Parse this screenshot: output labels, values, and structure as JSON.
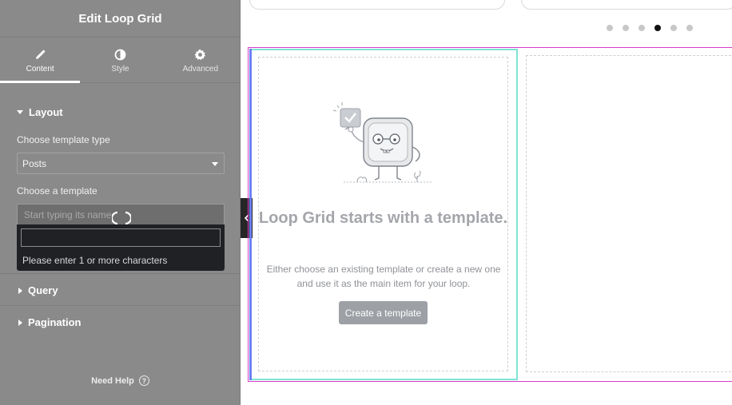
{
  "panel": {
    "title": "Edit Loop Grid",
    "tabs": [
      {
        "label": "Content",
        "icon": "pencil-icon",
        "active": true
      },
      {
        "label": "Style",
        "icon": "half-circle-icon",
        "active": false
      },
      {
        "label": "Advanced",
        "icon": "gear-icon",
        "active": false
      }
    ],
    "sections": {
      "layout": "Layout",
      "query": "Query",
      "pagination": "Pagination"
    },
    "template_type_label": "Choose template type",
    "template_type_value": "Posts",
    "template_label": "Choose a template",
    "template_placeholder": "Start typing its name",
    "dropdown_message": "Please enter 1 or more characters",
    "need_help": "Need Help"
  },
  "canvas": {
    "carousel_dots": 6,
    "active_dot": 3,
    "empty_title": "Loop Grid starts with a template.",
    "empty_desc": "Either choose an existing template or create a new one and use it as the main item for your loop.",
    "create_button": "Create a template"
  },
  "colors": {
    "sidebar_bg": "#8a8a8a",
    "dropdown_bg": "#1f2124",
    "section_outline": "#d63cc8",
    "column_outline": "#7ee4d3",
    "button_bg": "#9da0a5"
  }
}
